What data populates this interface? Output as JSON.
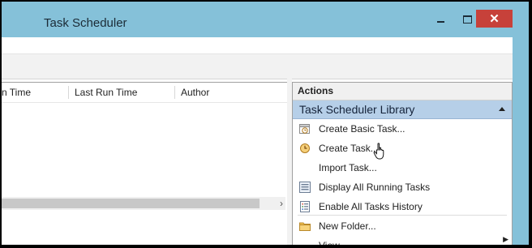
{
  "window": {
    "title": "Task Scheduler",
    "minimize": "minimize",
    "maximize": "maximize",
    "close_glyph": "✕"
  },
  "table": {
    "columns": [
      "n Time",
      "Last Run Time",
      "Author"
    ],
    "scroll_right_glyph": "›"
  },
  "actions": {
    "header": "Actions",
    "section": "Task Scheduler Library",
    "items": [
      {
        "label": "Create Basic Task...",
        "icon": "calendar-clock-icon"
      },
      {
        "label": "Create Task...",
        "icon": "clock-icon"
      },
      {
        "label": "Import Task...",
        "icon": ""
      },
      {
        "label": "Display All Running Tasks",
        "icon": "running-tasks-icon"
      },
      {
        "label": "Enable All Tasks History",
        "icon": "history-icon"
      },
      {
        "label": "New Folder...",
        "icon": "folder-icon"
      },
      {
        "label": "View",
        "icon": ""
      }
    ]
  },
  "colors": {
    "titlebar": "#85c1d9",
    "close": "#c7413a",
    "section": "#b6cfe8"
  }
}
